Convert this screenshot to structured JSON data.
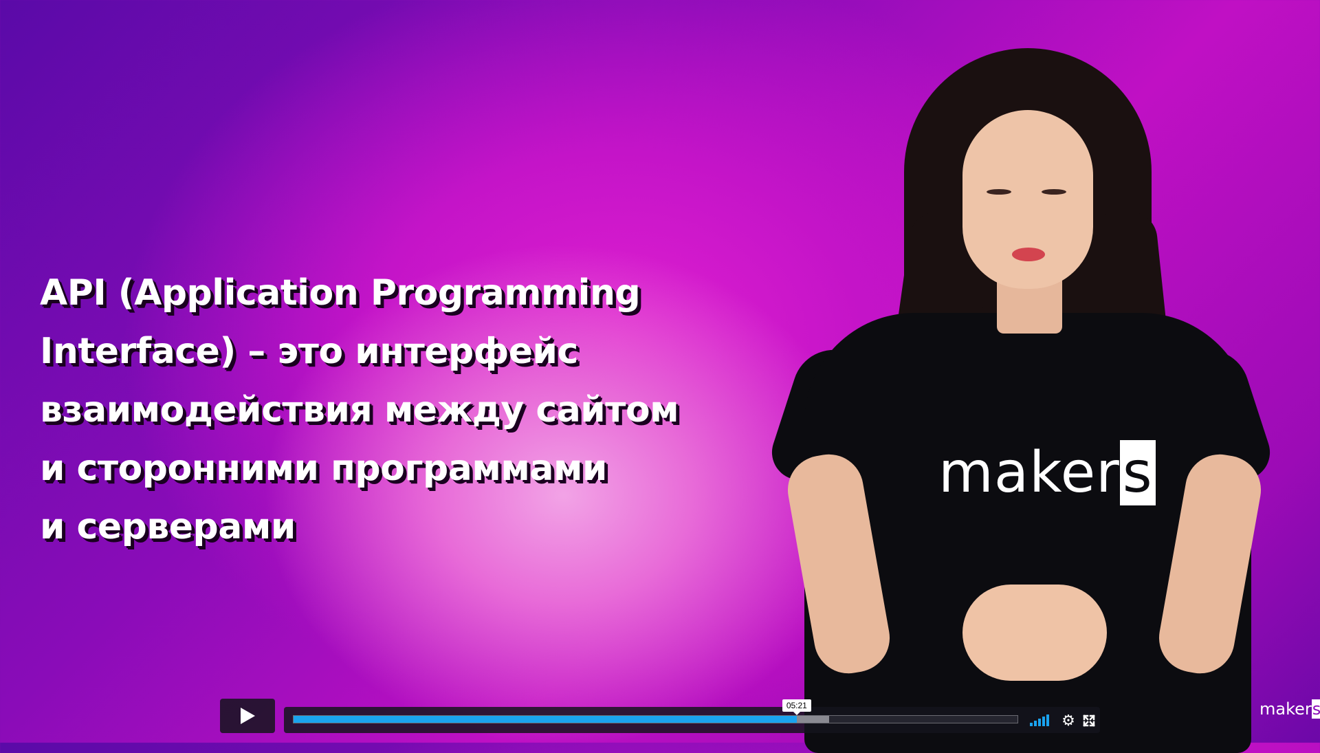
{
  "slide": {
    "headline_lines": [
      "API (Application Programming",
      "Interface) – это интерфейс",
      "взаимодействия между сайтом",
      "и сторонними программами",
      "и серверами"
    ],
    "shirt_logo_main": "maker",
    "shirt_logo_last": "s"
  },
  "player": {
    "play_icon": "play-icon",
    "current_time_tooltip": "05:21",
    "progress_played_fraction": 0.695,
    "progress_buffered_fraction": 0.74,
    "volume_icon": "volume-bars-icon",
    "settings_icon": "gear-icon",
    "fullscreen_icon": "fullscreen-icon",
    "accent_color": "#1aa3ef"
  },
  "watermark": {
    "main": "maker",
    "last": "s"
  }
}
